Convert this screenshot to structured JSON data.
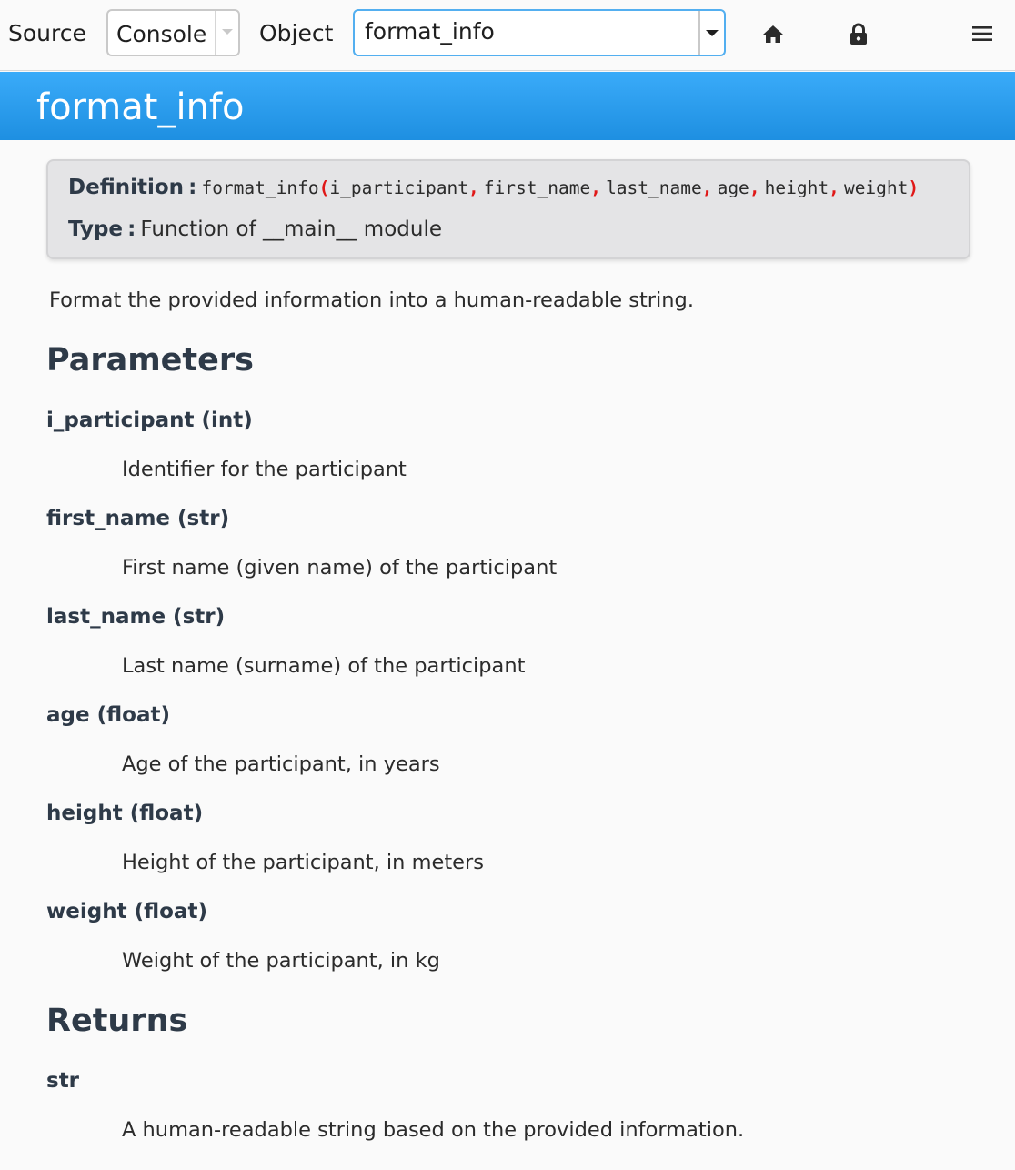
{
  "toolbar": {
    "source_label": "Source",
    "console_value": "Console",
    "object_label": "Object",
    "object_value": "format_info",
    "icons": [
      "home-icon",
      "lock-icon",
      "menu-icon"
    ]
  },
  "header": {
    "title": "format_info"
  },
  "definition": {
    "definition_label": "Definition",
    "type_label": "Type",
    "colon": ":",
    "func_name": "format_info",
    "open_paren": "(",
    "close_paren": ")",
    "comma": ",",
    "args": [
      "i_participant",
      "first_name",
      "last_name",
      "age",
      "height",
      "weight"
    ],
    "type_value": "Function of __main__ module"
  },
  "summary": "Format the provided information into a human-readable string.",
  "parameters": {
    "heading": "Parameters",
    "items": [
      {
        "name": "i_participant (int)",
        "desc": "Identifier for the participant"
      },
      {
        "name": "first_name (str)",
        "desc": "First name (given name) of the participant"
      },
      {
        "name": "last_name (str)",
        "desc": "Last name (surname) of the participant"
      },
      {
        "name": "age (float)",
        "desc": "Age of the participant, in years"
      },
      {
        "name": "height (float)",
        "desc": "Height of the participant, in meters"
      },
      {
        "name": "weight (float)",
        "desc": "Weight of the participant, in kg"
      }
    ]
  },
  "returns": {
    "heading": "Returns",
    "type": "str",
    "desc": "A human-readable string based on the provided information."
  },
  "colors": {
    "accent": "#2196f3",
    "punctuation": "#e01818",
    "heading": "#2e3a48"
  }
}
